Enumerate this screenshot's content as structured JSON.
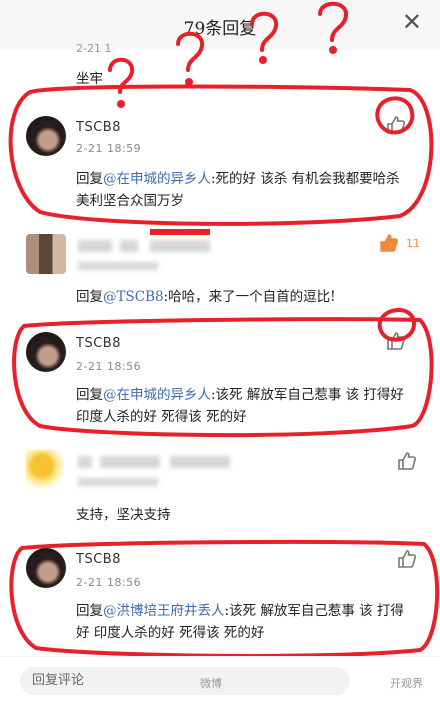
{
  "header": {
    "title": "79条回复",
    "close_icon": "close-icon"
  },
  "top_comment": {
    "time_partial": "2-21 1",
    "text": "坐牢"
  },
  "comments": [
    {
      "name": "TSCB8",
      "time": "2-21 18:59",
      "reply_prefix": "回复",
      "mention": "@在申城的异乡人",
      "text": ":死的好 该杀 有机会我都要哈杀 美利坚合众国万岁"
    },
    {
      "name": "",
      "time": "",
      "likes": "11",
      "reply_prefix": "回复",
      "mention": "@TSCB8",
      "text": ":哈哈，来了一个自首的逗比!"
    },
    {
      "name": "TSCB8",
      "time": "2-21 18:56",
      "reply_prefix": "回复",
      "mention": "@在申城的异乡人",
      "text": ":该死 解放军自己惹事 该 打得好 印度人杀的好 死得该 死的好"
    },
    {
      "name": "",
      "time": "",
      "reply_prefix": "",
      "mention": "",
      "text": "支持，坚决支持"
    },
    {
      "name": "TSCB8",
      "time": "2-21 18:56",
      "reply_prefix": "回复",
      "mention": "@洪博培王府井丢人",
      "text": ":该死 解放军自己惹事 该 打得好 印度人杀的好 死得该 死的好"
    }
  ],
  "footer": {
    "reply_placeholder": "回复评论",
    "watermark_left": "微博",
    "watermark_right": "开观界"
  },
  "colors": {
    "annotation_red": "#e8202a",
    "mention_blue": "#3b6db3",
    "like_orange": "#f08a3a"
  }
}
